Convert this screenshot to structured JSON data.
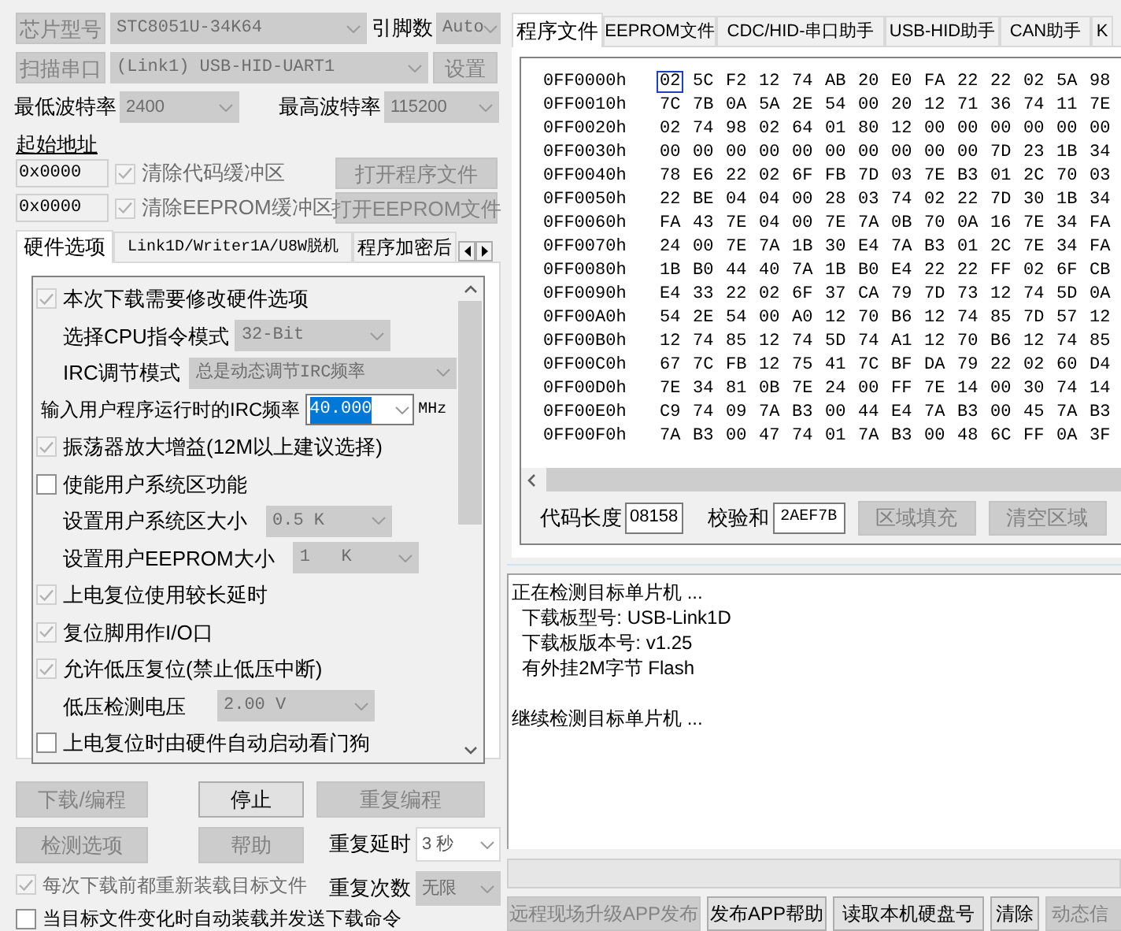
{
  "chip_row": {
    "button": {
      "label": "芯片型号",
      "disabled": true
    },
    "model": {
      "value": "STC8051U-34K64",
      "disabled": true
    },
    "pins_label": "引脚数",
    "pins": {
      "value": "Auto",
      "disabled": true
    }
  },
  "port_row": {
    "button": {
      "label": "扫描串口",
      "disabled": true
    },
    "port": {
      "value": "(Link1) USB-HID-UART1",
      "disabled": true
    },
    "settings_button": {
      "label": "设置",
      "disabled": true
    }
  },
  "baud_row": {
    "min_label": "最低波特率",
    "min": {
      "value": "2400",
      "disabled": true
    },
    "max_label": "最高波特率",
    "max": {
      "value": "115200",
      "disabled": true
    }
  },
  "start_address_label": "起始地址",
  "buffers": [
    {
      "address": "0x0000",
      "checkbox": {
        "label": "清除代码缓冲区",
        "checked": true,
        "disabled": true
      },
      "button": {
        "label": "打开程序文件",
        "disabled": true
      }
    },
    {
      "address": "0x0000",
      "checkbox": {
        "label": "清除EEPROM缓冲区",
        "checked": true,
        "disabled": true
      },
      "button": {
        "label": "打开EEPROM文件",
        "disabled": true
      }
    }
  ],
  "option_tabs": [
    {
      "label": "硬件选项",
      "selected": true
    },
    {
      "label": "Link1D/Writer1A/U8W脱机",
      "selected": false
    },
    {
      "label": "程序加密后",
      "selected": false
    }
  ],
  "hardware_options": [
    {
      "kind": "checkbox",
      "label": "本次下载需要修改硬件选项",
      "checked": true,
      "disabled": true
    },
    {
      "kind": "select",
      "label": "选择CPU指令模式",
      "value": "32-Bit",
      "disabled": true
    },
    {
      "kind": "select",
      "label": "IRC调节模式",
      "value": "总是动态调节IRC频率",
      "disabled": true
    },
    {
      "kind": "input",
      "label": "输入用户程序运行时的IRC频率",
      "value": "40.000",
      "text_selected": true,
      "unit": "MHz"
    },
    {
      "kind": "checkbox",
      "label": "振荡器放大增益(12M以上建议选择)",
      "checked": true,
      "disabled": true
    },
    {
      "kind": "checkbox",
      "label": "使能用户系统区功能",
      "checked": false,
      "disabled": false
    },
    {
      "kind": "select",
      "label": "设置用户系统区大小",
      "value": "0.5 K",
      "disabled": true
    },
    {
      "kind": "select",
      "label": "设置用户EEPROM大小",
      "value": "1   K",
      "disabled": true
    },
    {
      "kind": "checkbox",
      "label": "上电复位使用较长延时",
      "checked": true,
      "disabled": true
    },
    {
      "kind": "checkbox",
      "label": "复位脚用作I/O口",
      "checked": true,
      "disabled": true
    },
    {
      "kind": "checkbox",
      "label": "允许低压复位(禁止低压中断)",
      "checked": true,
      "disabled": true
    },
    {
      "kind": "select",
      "label": "低压检测电压",
      "value": "2.00 V",
      "disabled": true
    },
    {
      "kind": "checkbox",
      "label": "上电复位时由硬件自动启动看门狗",
      "checked": false,
      "disabled": false
    }
  ],
  "actions": {
    "download": {
      "label": "下载/编程",
      "disabled": true
    },
    "stop": {
      "label": "停止",
      "disabled": false
    },
    "repeat": {
      "label": "重复编程",
      "disabled": true
    },
    "detect": {
      "label": "检测选项",
      "disabled": true
    },
    "help": {
      "label": "帮助",
      "disabled": true
    },
    "repeat_delay_label": "重复延时",
    "repeat_delay": {
      "value": "3 秒",
      "disabled": false
    },
    "repeat_count_label": "重复次数",
    "repeat_count": {
      "value": "无限",
      "disabled": true
    },
    "reload_checkbox": {
      "label": "每次下载前都重新装载目标文件",
      "checked": true,
      "disabled": true
    },
    "auto_checkbox": {
      "label": "当目标文件变化时自动装载并发送下载命令",
      "checked": false,
      "disabled": false
    }
  },
  "file_tabs": [
    {
      "label": "程序文件",
      "selected": true
    },
    {
      "label": "EEPROM文件",
      "selected": false
    },
    {
      "label": "CDC/HID-串口助手",
      "selected": false
    },
    {
      "label": "USB-HID助手",
      "selected": false
    },
    {
      "label": "CAN助手",
      "selected": false
    },
    {
      "label": "K",
      "selected": false
    }
  ],
  "hex_rows": [
    {
      "address": "0FF0000h",
      "cursor": true,
      "bytes": [
        "02",
        "5C",
        "F2",
        "12",
        "74",
        "AB",
        "20",
        "E0",
        "FA",
        "22",
        "22",
        "02",
        "5A",
        "98"
      ]
    },
    {
      "address": "0FF0010h",
      "cursor": false,
      "bytes": [
        "7C",
        "7B",
        "0A",
        "5A",
        "2E",
        "54",
        "00",
        "20",
        "12",
        "71",
        "36",
        "74",
        "11",
        "7E"
      ]
    },
    {
      "address": "0FF0020h",
      "cursor": false,
      "bytes": [
        "02",
        "74",
        "98",
        "02",
        "64",
        "01",
        "80",
        "12",
        "00",
        "00",
        "00",
        "00",
        "00",
        "00"
      ]
    },
    {
      "address": "0FF0030h",
      "cursor": false,
      "bytes": [
        "00",
        "00",
        "00",
        "00",
        "00",
        "00",
        "00",
        "00",
        "00",
        "00",
        "7D",
        "23",
        "1B",
        "34"
      ]
    },
    {
      "address": "0FF0040h",
      "cursor": false,
      "bytes": [
        "78",
        "E6",
        "22",
        "02",
        "6F",
        "FB",
        "7D",
        "03",
        "7E",
        "B3",
        "01",
        "2C",
        "70",
        "03"
      ]
    },
    {
      "address": "0FF0050h",
      "cursor": false,
      "bytes": [
        "22",
        "BE",
        "04",
        "04",
        "00",
        "28",
        "03",
        "74",
        "02",
        "22",
        "7D",
        "30",
        "1B",
        "34"
      ]
    },
    {
      "address": "0FF0060h",
      "cursor": false,
      "bytes": [
        "FA",
        "43",
        "7E",
        "04",
        "00",
        "7E",
        "7A",
        "0B",
        "70",
        "0A",
        "16",
        "7E",
        "34",
        "FA"
      ]
    },
    {
      "address": "0FF0070h",
      "cursor": false,
      "bytes": [
        "24",
        "00",
        "7E",
        "7A",
        "1B",
        "30",
        "E4",
        "7A",
        "B3",
        "01",
        "2C",
        "7E",
        "34",
        "FA"
      ]
    },
    {
      "address": "0FF0080h",
      "cursor": false,
      "bytes": [
        "1B",
        "B0",
        "44",
        "40",
        "7A",
        "1B",
        "B0",
        "E4",
        "22",
        "22",
        "FF",
        "02",
        "6F",
        "CB"
      ]
    },
    {
      "address": "0FF0090h",
      "cursor": false,
      "bytes": [
        "E4",
        "33",
        "22",
        "02",
        "6F",
        "37",
        "CA",
        "79",
        "7D",
        "73",
        "12",
        "74",
        "5D",
        "0A"
      ]
    },
    {
      "address": "0FF00A0h",
      "cursor": false,
      "bytes": [
        "54",
        "2E",
        "54",
        "00",
        "A0",
        "12",
        "70",
        "B6",
        "12",
        "74",
        "85",
        "7D",
        "57",
        "12"
      ]
    },
    {
      "address": "0FF00B0h",
      "cursor": false,
      "bytes": [
        "12",
        "74",
        "85",
        "12",
        "74",
        "5D",
        "74",
        "A1",
        "12",
        "70",
        "B6",
        "12",
        "74",
        "85"
      ]
    },
    {
      "address": "0FF00C0h",
      "cursor": false,
      "bytes": [
        "67",
        "7C",
        "FB",
        "12",
        "75",
        "41",
        "7C",
        "BF",
        "DA",
        "79",
        "22",
        "02",
        "60",
        "D4"
      ]
    },
    {
      "address": "0FF00D0h",
      "cursor": false,
      "bytes": [
        "7E",
        "34",
        "81",
        "0B",
        "7E",
        "24",
        "00",
        "FF",
        "7E",
        "14",
        "00",
        "30",
        "74",
        "14"
      ]
    },
    {
      "address": "0FF00E0h",
      "cursor": false,
      "bytes": [
        "C9",
        "74",
        "09",
        "7A",
        "B3",
        "00",
        "44",
        "E4",
        "7A",
        "B3",
        "00",
        "45",
        "7A",
        "B3"
      ]
    },
    {
      "address": "0FF00F0h",
      "cursor": false,
      "bytes": [
        "7A",
        "B3",
        "00",
        "47",
        "74",
        "01",
        "7A",
        "B3",
        "00",
        "48",
        "6C",
        "FF",
        "0A",
        "3F"
      ]
    }
  ],
  "hex_footer": {
    "length_label": "代码长度",
    "length": "08158",
    "checksum_label": "校验和",
    "checksum": "2AEF7B",
    "fill_button": {
      "label": "区域填充",
      "disabled": true
    },
    "clear_button": {
      "label": "清空区域",
      "disabled": true
    }
  },
  "log": {
    "text": "正在检测目标单片机 ...\n  下载板型号: USB-Link1D\n  下载板版本号: v1.25\n  有外挂2M字节 Flash\n\n继续检测目标单片机 ..."
  },
  "bottom_buttons": [
    {
      "label": "远程现场升级APP发布",
      "disabled": true
    },
    {
      "label": "发布APP帮助",
      "disabled": false
    },
    {
      "label": "读取本机硬盘号",
      "disabled": false
    },
    {
      "label": "清除",
      "disabled": false
    },
    {
      "label": "动态信",
      "disabled": true
    }
  ]
}
